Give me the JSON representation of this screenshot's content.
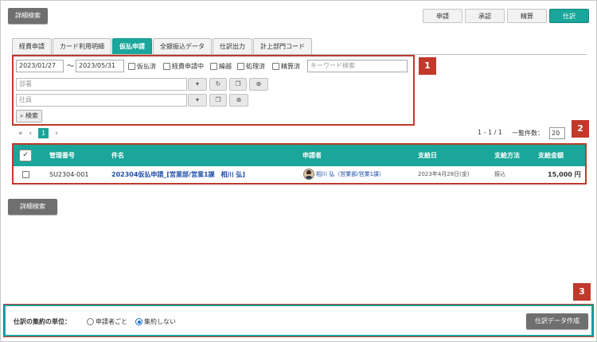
{
  "top": {
    "detail_search_label": "詳細検索"
  },
  "modes": [
    {
      "label": "申請",
      "active": false
    },
    {
      "label": "承認",
      "active": false
    },
    {
      "label": "精算",
      "active": false
    },
    {
      "label": "仕訳",
      "active": true
    }
  ],
  "tabs": [
    {
      "label": "経費申請"
    },
    {
      "label": "カード利用明細"
    },
    {
      "label": "仮払申請"
    },
    {
      "label": "全銀振込データ"
    },
    {
      "label": "仕訳出力"
    },
    {
      "label": "計上部門コード"
    }
  ],
  "active_tab": "仮払申請",
  "filters": {
    "date_from": "2023/01/27",
    "date_separator": "～",
    "date_to": "2023/05/31",
    "checkboxes": [
      "仮払済",
      "経費申請中",
      "繰越",
      "処理済",
      "精算済"
    ],
    "keyword_placeholder": "キーワード検索",
    "department_placeholder": "部署",
    "employee_placeholder": "社員",
    "search_button": "検索"
  },
  "markers": {
    "m1": "1",
    "m2": "2",
    "m3": "3"
  },
  "pager": {
    "first": "«",
    "prev": "‹",
    "current": "1",
    "next": "›",
    "range_text": "1 - 1 / 1",
    "per_page_label": "一覧件数：",
    "per_page": "20"
  },
  "table": {
    "header_check": "✓",
    "columns": [
      "管理番号",
      "件名",
      "申請者",
      "支給日",
      "支給方法",
      "支給金額"
    ],
    "rows": [
      {
        "id": "SU2304-001",
        "subject": "202304仮払申請_[営業部/営業1課　相川 弘]",
        "applicant": "相川 弘（営業部/営業1課）",
        "pay_date": "2023年4月28日(金)",
        "method": "振込",
        "amount": "15,000 円"
      }
    ]
  },
  "bottom": {
    "detail_search_label": "詳細検索"
  },
  "footer": {
    "label": "仕訳の集約の単位：",
    "options": [
      {
        "label": "申請者ごと",
        "selected": false
      },
      {
        "label": "集約しない",
        "selected": true
      }
    ],
    "create_button": "仕訳データ作成"
  },
  "colors": {
    "accent": "#1aa69a",
    "marker": "#c0392b",
    "link": "#1f4fa8"
  },
  "icons": [
    "chevron-down-icon",
    "refresh-icon",
    "copy-icon",
    "clear-icon",
    "search-icon",
    "avatar-icon"
  ]
}
